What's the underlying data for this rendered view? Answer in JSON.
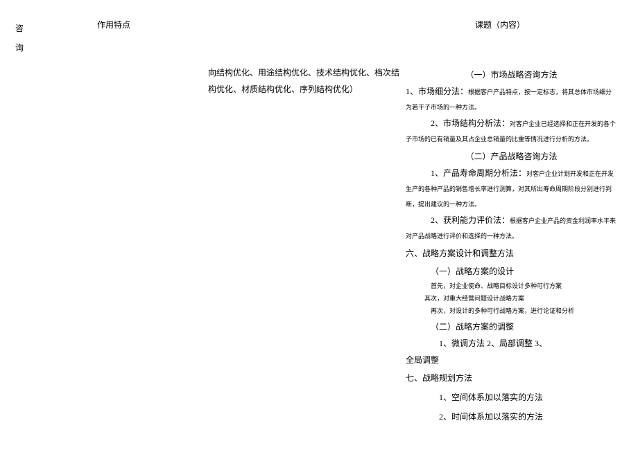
{
  "header": {
    "left": "咨\n询",
    "mid": "作用特点",
    "right": "课题（内容）"
  },
  "leftText": "向结构优化、用途结构优化、技术结构优化、档次结构优化、材质结构优化、序列结构优化）",
  "sections": {
    "s1": {
      "title": "（一）市场战略咨询方法",
      "m1": {
        "label": "1、市场细分法：",
        "body": "根据客户产品特点，按一定标志，将其总体市场细分为若干子市场的一种方法。"
      },
      "m2": {
        "label": "2、市场结构分析法：",
        "body": "对客户企业已经选择和正在开发的各个子市场的已有销量及其占企业总销量的比重等情况进行分析的方法。"
      }
    },
    "s2": {
      "title": "（二）产品战略咨询方法",
      "m1": {
        "label": "1、产品寿命周期分析法：",
        "body": "对客户企业计划开发和正在开发生产的各种产品的销售增长率进行测算，对其所出寿命周期阶段分别进行判断，提出建议的一种方法。"
      },
      "m2": {
        "label": "2、获利能力评价法：",
        "body": "根据客户企业产品的资金利润率水平来对产品战略进行评价和选择的一种方法。"
      }
    },
    "s6": {
      "title": "六、战略方案设计和调整方法",
      "sub1": {
        "title": "（一）战略方案的设计",
        "line1": "首先，对企业使命、战略目标设计多种可行方案",
        "line2": "其次，对重大经营问题设计战略方案",
        "line3": "再次，对设计的多种可行战略方案，进行论证和分析"
      },
      "sub2": {
        "title": "（二）战略方案的调整",
        "line1": "1、微调方法 2、局部调整 3、全局调整",
        "line1a": "1、微调方法 2、局部调整 3、",
        "line1b": "全局调整"
      }
    },
    "s7": {
      "title": "七、战略规划方法",
      "line1": "1、空间体系加以落实的方法",
      "line2": "2、时间体系加以落实的方法"
    }
  }
}
